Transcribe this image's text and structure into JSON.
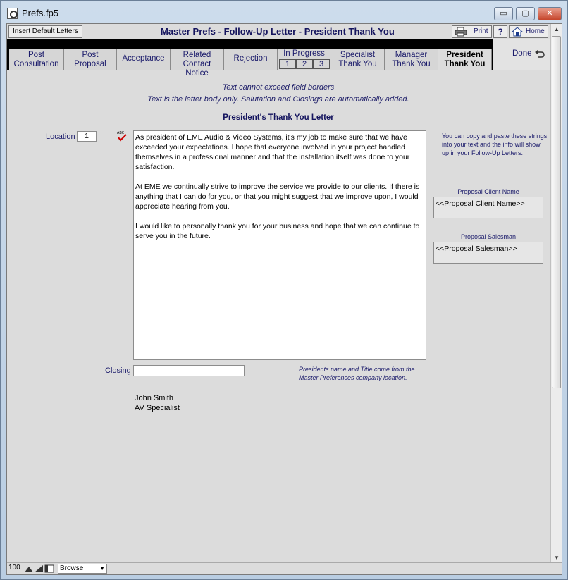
{
  "window": {
    "title": "Prefs.fp5"
  },
  "window_controls": {
    "minimize": "▭",
    "maximize": "▢",
    "close": "✕"
  },
  "header": {
    "insert_defaults_label": "Insert Default Letters",
    "title": "Master Prefs - Follow-Up Letter - President Thank You",
    "print_label": "Print",
    "help_label": "?",
    "home_label": "Home"
  },
  "tabs": [
    {
      "line1": "Post",
      "line2": "Consultation"
    },
    {
      "line1": "Post",
      "line2": "Proposal"
    },
    {
      "line1": "Acceptance",
      "line2": ""
    },
    {
      "line1": "Related",
      "line2": "Contact Notice"
    },
    {
      "line1": "Rejection",
      "line2": ""
    },
    {
      "line1": "In Progress",
      "sub": [
        "1",
        "2",
        "3"
      ]
    },
    {
      "line1": "Specialist",
      "line2": "Thank You"
    },
    {
      "line1": "Manager",
      "line2": "Thank You"
    },
    {
      "line1": "President",
      "line2": "Thank You"
    }
  ],
  "done_label": "Done",
  "notes": {
    "line1": "Text cannot exceed field borders",
    "line2": "Text is the letter body only.  Salutation and Closings are automatically added."
  },
  "section_title": "President's Thank You Letter",
  "location": {
    "label": "Location",
    "value": "1"
  },
  "letter": {
    "p1": "As president of EME Audio & Video Systems, it's my job to make sure that we have exceeded your expectations. I hope that everyone involved in your project handled themselves in a professional manner and that the   installation itself was done to your satisfaction.",
    "p2": "At EME we continually strive to improve the service we provide to our clients. If there is anything that I can do for you, or that you might suggest that we improve upon, I would appreciate hearing from you.",
    "p3": "I would like to personally thank you for your business and hope that we can continue to serve you in the future."
  },
  "right_panel": {
    "help": "You can copy and paste these strings into your text and the info will show up in your Follow-Up Letters.",
    "client_name_label": "Proposal Client Name",
    "client_name_value": "<<Proposal Client Name>>",
    "salesman_label": "Proposal Salesman",
    "salesman_value": "<<Proposal Salesman>>"
  },
  "closing": {
    "label": "Closing",
    "value": "",
    "note": "Presidents name and Title come from the Master Preferences company location."
  },
  "signature": {
    "name": "John Smith",
    "title": "AV Specialist"
  },
  "statusbar": {
    "zoom": "100",
    "mode": "Browse"
  }
}
